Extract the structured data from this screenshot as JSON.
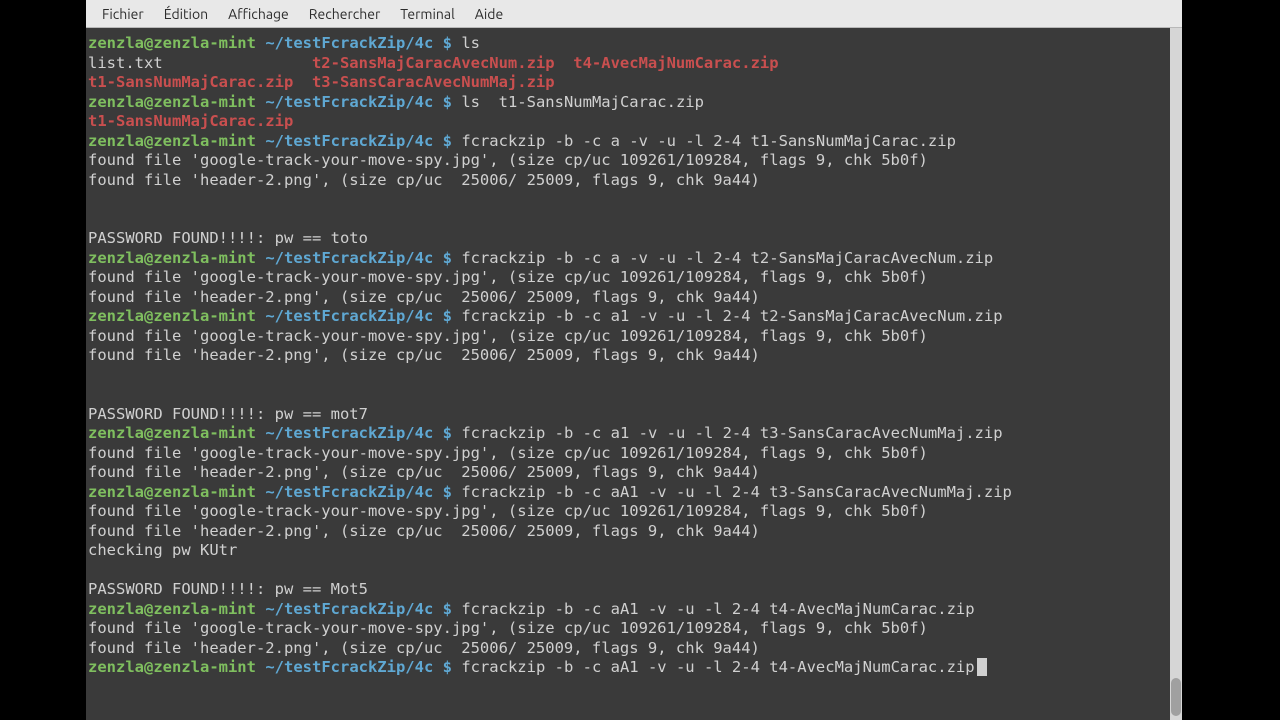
{
  "menu": {
    "items": [
      "Fichier",
      "Édition",
      "Affichage",
      "Rechercher",
      "Terminal",
      "Aide"
    ]
  },
  "prompt": {
    "user": "zenzla@zenzla-mint",
    "path": "~/testFcrackZip/4c",
    "symbol": "$"
  },
  "lines": [
    {
      "t": "prompt",
      "cmd": "ls"
    },
    {
      "t": "ls1",
      "c1": "list.txt",
      "c2": "t2-SansMajCaracAvecNum.zip",
      "c3": "t4-AvecMajNumCarac.zip"
    },
    {
      "t": "ls2",
      "c1": "t1-SansNumMajCarac.zip",
      "c2": "t3-SansCaracAvecNumMaj.zip"
    },
    {
      "t": "prompt",
      "cmd": "ls  t1-SansNumMajCarac.zip"
    },
    {
      "t": "zipline",
      "txt": "t1-SansNumMajCarac.zip"
    },
    {
      "t": "prompt",
      "cmd": "fcrackzip -b -c a -v -u -l 2-4 t1-SansNumMajCarac.zip"
    },
    {
      "t": "plain",
      "txt": "found file 'google-track-your-move-spy.jpg', (size cp/uc 109261/109284, flags 9, chk 5b0f)"
    },
    {
      "t": "plain",
      "txt": "found file 'header-2.png', (size cp/uc  25006/ 25009, flags 9, chk 9a44)"
    },
    {
      "t": "blank"
    },
    {
      "t": "blank"
    },
    {
      "t": "plain",
      "txt": "PASSWORD FOUND!!!!: pw == toto"
    },
    {
      "t": "prompt",
      "cmd": "fcrackzip -b -c a -v -u -l 2-4 t2-SansMajCaracAvecNum.zip"
    },
    {
      "t": "plain",
      "txt": "found file 'google-track-your-move-spy.jpg', (size cp/uc 109261/109284, flags 9, chk 5b0f)"
    },
    {
      "t": "plain",
      "txt": "found file 'header-2.png', (size cp/uc  25006/ 25009, flags 9, chk 9a44)"
    },
    {
      "t": "prompt",
      "cmd": "fcrackzip -b -c a1 -v -u -l 2-4 t2-SansMajCaracAvecNum.zip"
    },
    {
      "t": "plain",
      "txt": "found file 'google-track-your-move-spy.jpg', (size cp/uc 109261/109284, flags 9, chk 5b0f)"
    },
    {
      "t": "plain",
      "txt": "found file 'header-2.png', (size cp/uc  25006/ 25009, flags 9, chk 9a44)"
    },
    {
      "t": "blank"
    },
    {
      "t": "blank"
    },
    {
      "t": "plain",
      "txt": "PASSWORD FOUND!!!!: pw == mot7"
    },
    {
      "t": "prompt",
      "cmd": "fcrackzip -b -c a1 -v -u -l 2-4 t3-SansCaracAvecNumMaj.zip"
    },
    {
      "t": "plain",
      "txt": "found file 'google-track-your-move-spy.jpg', (size cp/uc 109261/109284, flags 9, chk 5b0f)"
    },
    {
      "t": "plain",
      "txt": "found file 'header-2.png', (size cp/uc  25006/ 25009, flags 9, chk 9a44)"
    },
    {
      "t": "prompt",
      "cmd": "fcrackzip -b -c aA1 -v -u -l 2-4 t3-SansCaracAvecNumMaj.zip"
    },
    {
      "t": "plain",
      "txt": "found file 'google-track-your-move-spy.jpg', (size cp/uc 109261/109284, flags 9, chk 5b0f)"
    },
    {
      "t": "plain",
      "txt": "found file 'header-2.png', (size cp/uc  25006/ 25009, flags 9, chk 9a44)"
    },
    {
      "t": "plain",
      "txt": "checking pw KUtr"
    },
    {
      "t": "blank"
    },
    {
      "t": "plain",
      "txt": "PASSWORD FOUND!!!!: pw == Mot5"
    },
    {
      "t": "prompt",
      "cmd": "fcrackzip -b -c aA1 -v -u -l 2-4 t4-AvecMajNumCarac.zip"
    },
    {
      "t": "plain",
      "txt": "found file 'google-track-your-move-spy.jpg', (size cp/uc 109261/109284, flags 9, chk 5b0f)"
    },
    {
      "t": "plain",
      "txt": "found file 'header-2.png', (size cp/uc  25006/ 25009, flags 9, chk 9a44)"
    },
    {
      "t": "prompt-cursor",
      "cmd": "fcrackzip -b -c aA1 -v -u -l 2-4 t4-AvecMajNumCarac.zip"
    }
  ]
}
